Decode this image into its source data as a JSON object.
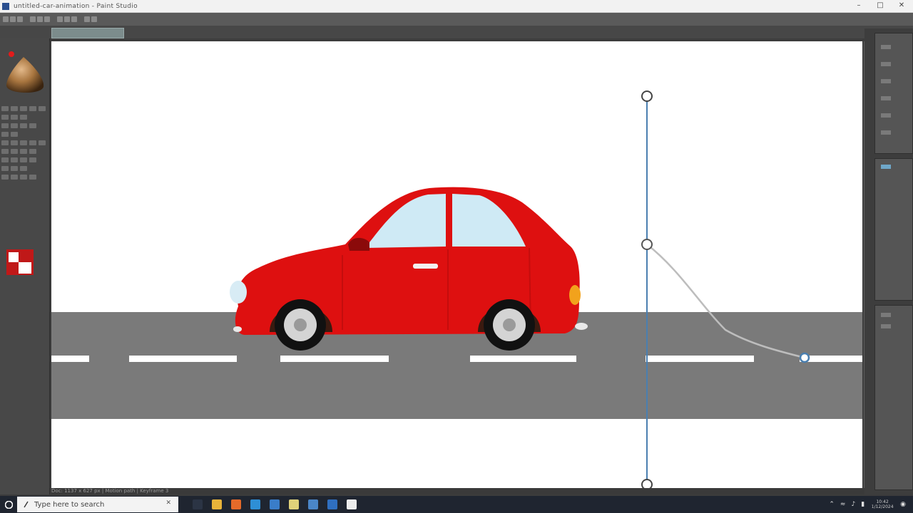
{
  "window": {
    "title": "untitled-car-animation - Paint Studio",
    "controls": {
      "minimize": "–",
      "maximize": "□",
      "close": "✕"
    }
  },
  "canvas": {
    "background_color": "#ffffff",
    "road_color": "#7a7a7a",
    "lane_color": "#ffffff",
    "car_body_color": "#de1010",
    "window_color": "#cfeaf5",
    "motion_path_color": "#4a7fb0"
  },
  "tools": {
    "brush_preview": "brush-preview",
    "primary_color": "#c01818",
    "secondary_color": "#ffffff"
  },
  "statusbar": {
    "text": "Doc: 1137 x 627 px  |  Motion path  |  Keyframe 3"
  },
  "taskbar": {
    "search_placeholder": "Type here to search",
    "search_close": "✕",
    "apps": [
      {
        "name": "task-view",
        "color": "#2b3444"
      },
      {
        "name": "file-explorer",
        "color": "#e8b33a"
      },
      {
        "name": "browser",
        "color": "#e56a2a"
      },
      {
        "name": "mail",
        "color": "#2e8fd6"
      },
      {
        "name": "store",
        "color": "#3a7dc9"
      },
      {
        "name": "notes",
        "color": "#e0d27a"
      },
      {
        "name": "settings",
        "color": "#4a86c8"
      },
      {
        "name": "photos",
        "color": "#2f6fc0"
      },
      {
        "name": "calendar",
        "color": "#ececec"
      }
    ],
    "clock_time": "10:42",
    "clock_date": "1/12/2024"
  }
}
